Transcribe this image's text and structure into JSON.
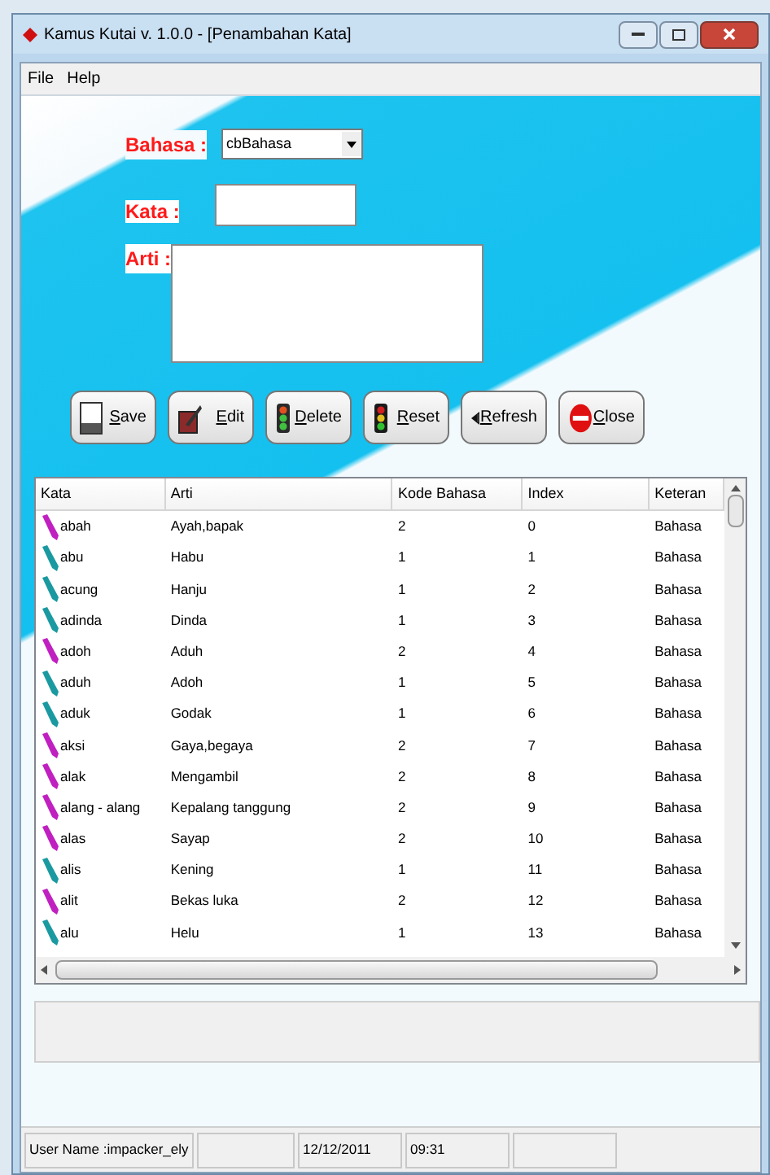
{
  "window": {
    "title": "Kamus Kutai v. 1.0.0 - [Penambahan Kata]"
  },
  "menu": [
    "File",
    "Help"
  ],
  "form": {
    "bahasa_label": "Bahasa :",
    "bahasa_value": "cbBahasa",
    "kata_label": "Kata :",
    "arti_label": "Arti :"
  },
  "buttons": [
    {
      "label": "Save",
      "kind": "save"
    },
    {
      "label": "Edit",
      "kind": "edit"
    },
    {
      "label": "Delete",
      "kind": "delete"
    },
    {
      "label": "Reset",
      "kind": "reset"
    },
    {
      "label": "Refresh",
      "kind": "refresh"
    },
    {
      "label": "Close",
      "kind": "close"
    }
  ],
  "table": {
    "columns": [
      "Kata",
      "Arti",
      "Kode Bahasa",
      "Index",
      "Keteran"
    ],
    "rows": [
      {
        "cells": [
          "abah",
          "Ayah,bapak",
          "2",
          "0",
          "Bahasa"
        ],
        "color": "#c020c0"
      },
      {
        "cells": [
          "abu",
          "Habu",
          "1",
          "1",
          "Bahasa"
        ],
        "color": "#1a9aa0"
      },
      {
        "cells": [
          "acung",
          "Hanju",
          "1",
          "2",
          "Bahasa"
        ],
        "color": "#1a9aa0"
      },
      {
        "cells": [
          "adinda",
          "Dinda",
          "1",
          "3",
          "Bahasa"
        ],
        "color": "#1a9aa0"
      },
      {
        "cells": [
          "adoh",
          "Aduh",
          "2",
          "4",
          "Bahasa"
        ],
        "color": "#c020c0"
      },
      {
        "cells": [
          "aduh",
          "Adoh",
          "1",
          "5",
          "Bahasa"
        ],
        "color": "#1a9aa0"
      },
      {
        "cells": [
          "aduk",
          "Godak",
          "1",
          "6",
          "Bahasa"
        ],
        "color": "#1a9aa0"
      },
      {
        "cells": [
          "aksi",
          "Gaya,begaya",
          "2",
          "7",
          "Bahasa"
        ],
        "color": "#c020c0"
      },
      {
        "cells": [
          "alak",
          "Mengambil",
          "2",
          "8",
          "Bahasa"
        ],
        "color": "#c020c0"
      },
      {
        "cells": [
          "alang - alang",
          "Kepalang tanggung",
          "2",
          "9",
          "Bahasa"
        ],
        "color": "#c020c0"
      },
      {
        "cells": [
          "alas",
          "Sayap",
          "2",
          "10",
          "Bahasa"
        ],
        "color": "#c020c0"
      },
      {
        "cells": [
          "alis",
          "Kening",
          "1",
          "11",
          "Bahasa"
        ],
        "color": "#1a9aa0"
      },
      {
        "cells": [
          "alit",
          "Bekas luka",
          "2",
          "12",
          "Bahasa"
        ],
        "color": "#c020c0"
      },
      {
        "cells": [
          "alu",
          "Helu",
          "1",
          "13",
          "Bahasa"
        ],
        "color": "#1a9aa0"
      }
    ]
  },
  "status_bar": {
    "user": "User Name :impacker_ely",
    "date": "12/12/2011",
    "time": "09:31"
  }
}
